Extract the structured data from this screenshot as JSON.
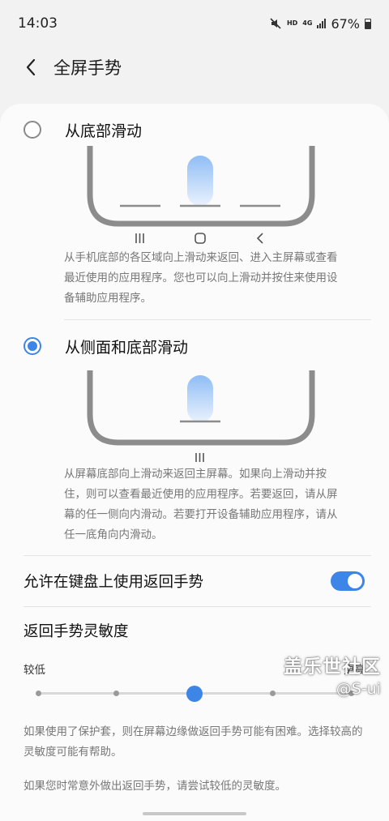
{
  "status_bar": {
    "time": "14:03",
    "hd": "HD",
    "network": "4G",
    "battery": "67%",
    "icons": [
      "mute-icon",
      "signal-icon",
      "battery-icon"
    ]
  },
  "app_bar": {
    "title": "全屏手势",
    "back_icon": "back-arrow-icon"
  },
  "options": [
    {
      "label": "从底部滑动",
      "selected": false,
      "description": "从手机底部的各区域向上滑动来返回、进入主屏幕或查看最近使用的应用程序。您也可以向上滑动并按住来使用设备辅助应用程序。",
      "nav_icons": [
        "recents-icon",
        "home-icon",
        "back-icon"
      ]
    },
    {
      "label": "从侧面和底部滑动",
      "selected": true,
      "description": "从屏幕底部向上滑动来返回主屏幕。如果向上滑动并按住，则可以查看最近使用的应用程序。若要返回，请从屏幕的任一侧向内滑动。若要打开设备辅助应用程序，请从任一底角向内滑动。",
      "nav_icons": [
        "recents-icon"
      ]
    }
  ],
  "keyboard_toggle": {
    "label": "允许在键盘上使用返回手势",
    "on": true
  },
  "sensitivity": {
    "title": "返回手势灵敏度",
    "low_label": "较低",
    "high_label": "更高",
    "steps": 5,
    "value_index": 2
  },
  "notes": [
    "如果使用了保护套，则在屏幕边缘做返回手势可能有困难。选择较高的灵敏度可能有帮助。",
    "如果您时常意外做出返回手势，请尝试较低的灵敏度。"
  ],
  "watermark": {
    "line1": "盖乐世社区",
    "line2": "@S-ui"
  },
  "colors": {
    "accent": "#3e85e8",
    "background": "#f2f2f2",
    "card": "#fbfbfb"
  }
}
